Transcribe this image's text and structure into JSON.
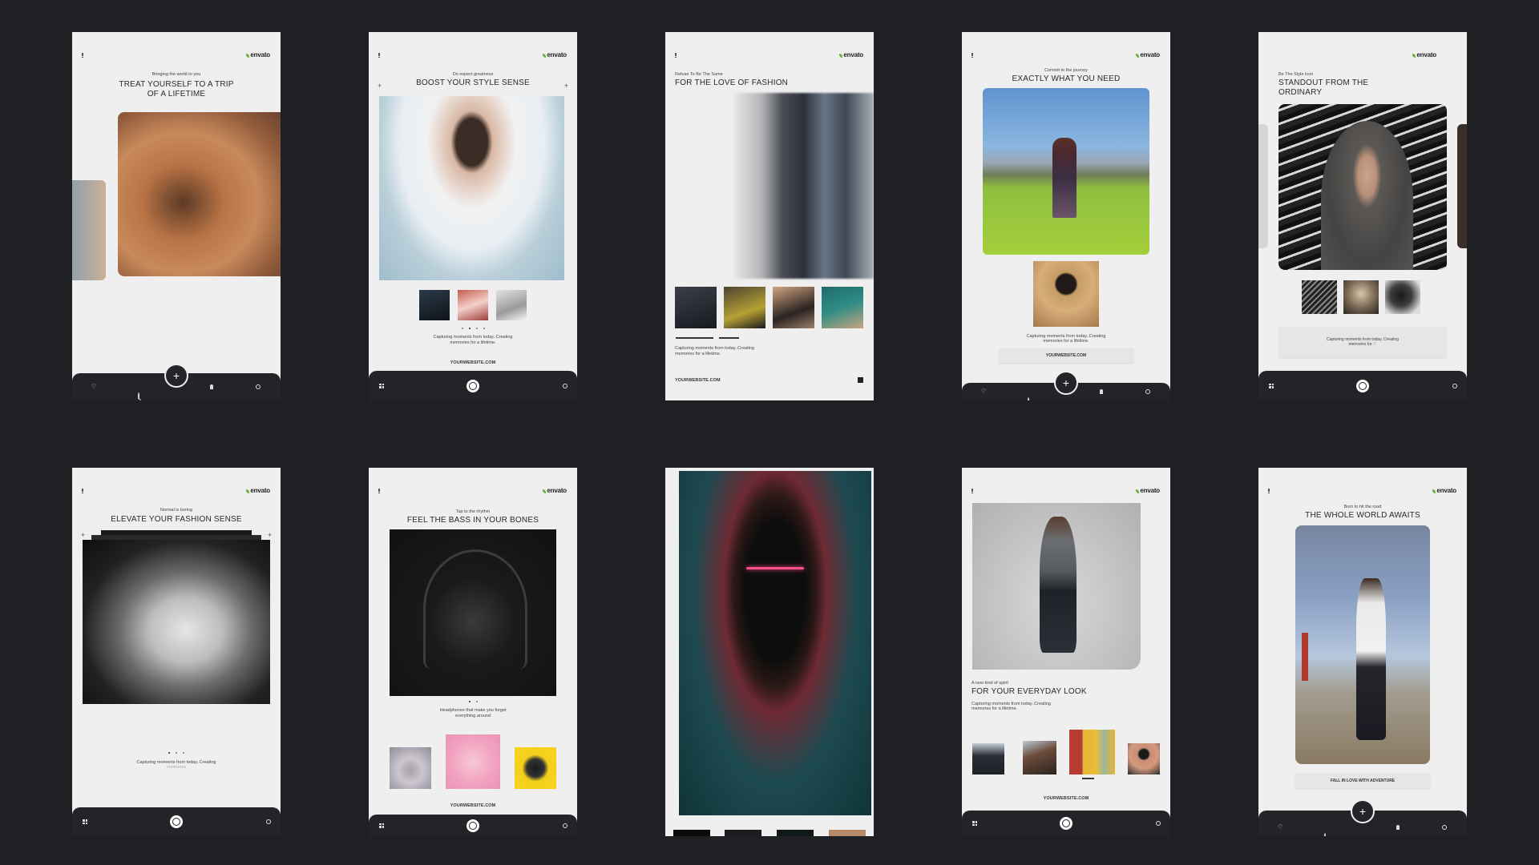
{
  "brand": "envato",
  "colors": {
    "background": "#1f2023",
    "card": "#efefef",
    "navbar": "#232428",
    "brand_leaf": "#6aaf2e"
  },
  "cards": [
    {
      "kicker": "Bringing the world to you",
      "title_line1": "TREAT YOURSELF TO A TRIP",
      "title_line2": "OF A LIFETIME",
      "nav": {
        "fab": "+",
        "icons": [
          "heart-icon",
          "search-icon",
          "bell-icon",
          "gear-icon"
        ]
      }
    },
    {
      "kicker": "Do expect greatness",
      "title": "BOOST YOUR STYLE SENSE",
      "caption_line1": "Capturing moments from today..Creating",
      "caption_line2": "memories for a lifetime.",
      "website": "YOURWEBSITE.COM",
      "pager": {
        "count": 4,
        "active": 2
      }
    },
    {
      "kicker": "Refuse To Be The Same",
      "title": "FOR THE LOVE OF FASHION",
      "caption_line1": "Capturing moments from today..Creating",
      "caption_line2": "memories for a lifetime.",
      "website": "YOURWEBSITE.COM"
    },
    {
      "kicker": "Commit to the journey",
      "title": "EXACTLY WHAT YOU NEED",
      "caption_line1": "Capturing moments from today..Creating",
      "caption_line2": "memories for a lifetime.",
      "button": "YOURWEBSITE.COM",
      "nav": {
        "fab": "+"
      }
    },
    {
      "kicker": "Be The Style Icon",
      "title_line1": "STANDOUT FROM THE",
      "title_line2": "ORDINARY",
      "caption_line1": "Capturing moments from today..Creating",
      "caption_line2": "memories for ♡"
    },
    {
      "kicker": "Normal is boring",
      "title": "ELEVATE YOUR FASHION SENSE",
      "caption_line1": "Capturing moments from today..Creating",
      "caption_line2": "memories",
      "pager": {
        "count": 3,
        "active": 1
      }
    },
    {
      "kicker": "Tap to the rhythm",
      "title": "FEEL THE BASS IN YOUR BONES",
      "caption_line1": "Headphones that make you forget",
      "caption_line2": "everything around",
      "website": "YOURWEBSITE.COM",
      "pager": {
        "count": 2,
        "active": 1
      }
    },
    {
      "kicker": "",
      "title": ""
    },
    {
      "kicker": "A new kind of spirit",
      "title": "FOR YOUR EVERYDAY LOOK",
      "caption_line1": "Capturing moments from today..Creating",
      "caption_line2": "memories for a lifetime.",
      "website": "YOURWEBSITE.COM"
    },
    {
      "kicker": "Born to hit the road",
      "title": "THE WHOLE WORLD AWAITS",
      "button": "FALL IN LOVE WITH ADVENTURE",
      "nav": {
        "fab": "+"
      }
    }
  ]
}
